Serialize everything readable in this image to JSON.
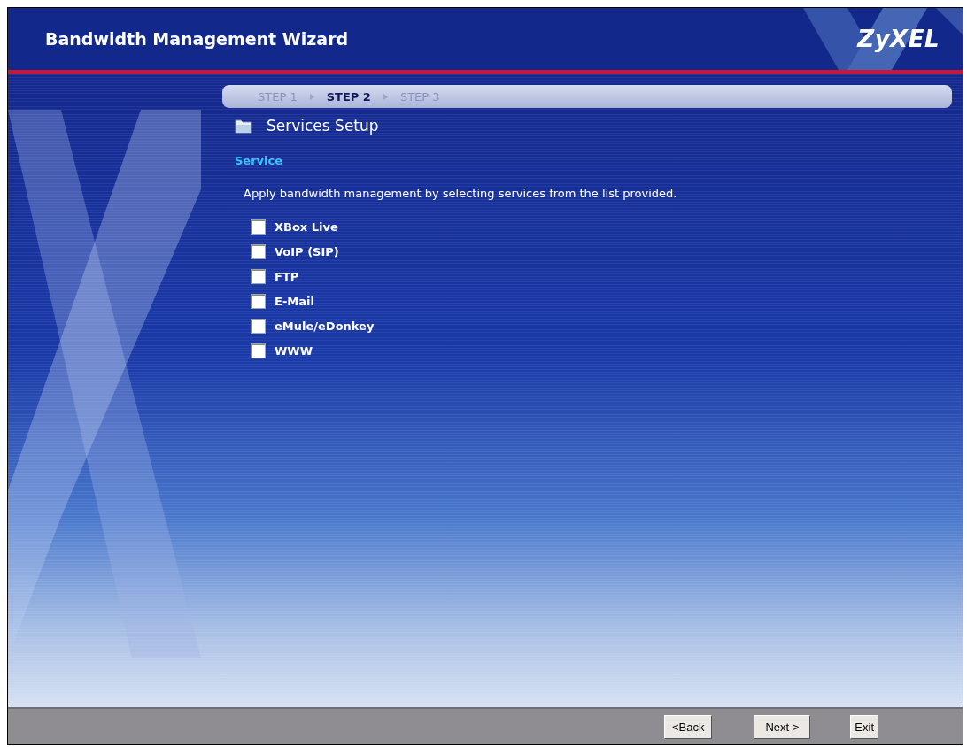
{
  "header": {
    "title": "Bandwidth Management Wizard",
    "logo": "ZyXEL"
  },
  "steps": [
    {
      "label": "STEP 1",
      "selected": false
    },
    {
      "label": "STEP 2",
      "selected": true
    },
    {
      "label": "STEP 3",
      "selected": false
    }
  ],
  "page": {
    "title": "Services Setup",
    "section": "Service",
    "description": "Apply bandwidth management by selecting services from the list provided."
  },
  "services": [
    {
      "label": "XBox Live",
      "checked": false
    },
    {
      "label": "VoIP (SIP)",
      "checked": false
    },
    {
      "label": "FTP",
      "checked": false
    },
    {
      "label": "E-Mail",
      "checked": false
    },
    {
      "label": "eMule/eDonkey",
      "checked": false
    },
    {
      "label": "WWW",
      "checked": false
    }
  ],
  "buttons": [
    "<Back",
    "Next >",
    "Exit"
  ]
}
